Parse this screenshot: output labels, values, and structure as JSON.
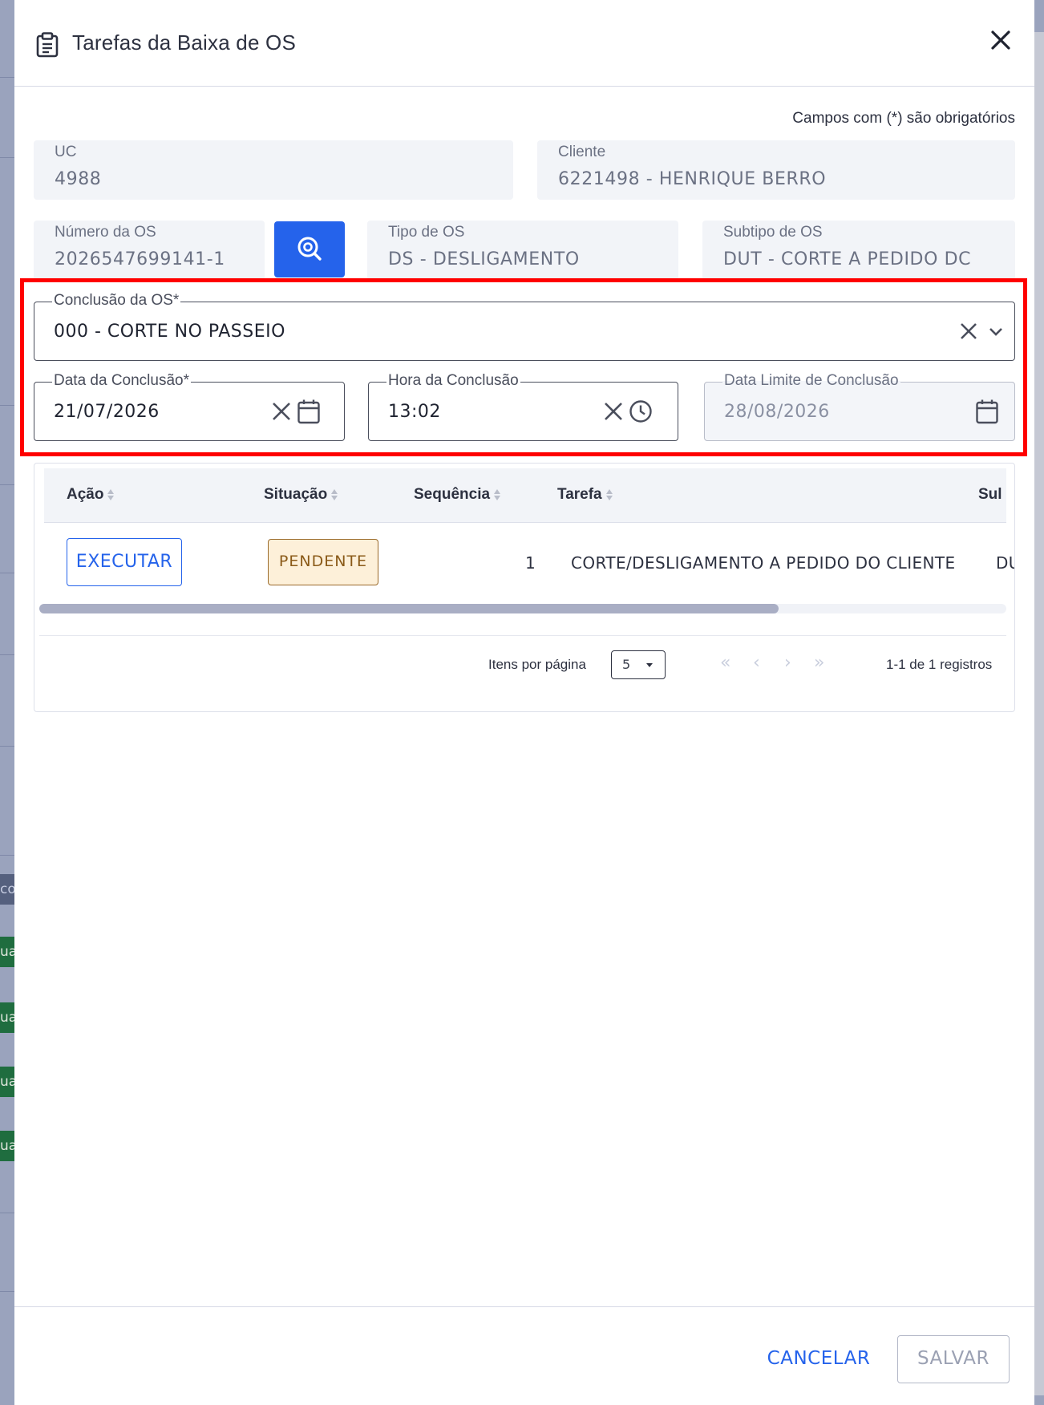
{
  "modal": {
    "title": "Tarefas da Baixa de OS",
    "required_note": "Campos com (*) são obrigatórios"
  },
  "fields": {
    "uc": {
      "label": "UC",
      "value": "4988"
    },
    "cliente": {
      "label": "Cliente",
      "value": "6221498 - HENRIQUE BERRO"
    },
    "numero_os": {
      "label": "Número da OS",
      "value": "2026547699141-1"
    },
    "tipo_os": {
      "label": "Tipo de OS",
      "value": "DS - DESLIGAMENTO"
    },
    "subtipo_os": {
      "label": "Subtipo de OS",
      "value": "DUT - CORTE A PEDIDO DC"
    },
    "conclusao_os": {
      "label": "Conclusão da OS*",
      "value": "000 - CORTE NO PASSEIO"
    },
    "data_conclusao": {
      "label": "Data da Conclusão*",
      "value": "21/07/2026"
    },
    "hora_conclusao": {
      "label": "Hora da Conclusão",
      "value": "13:02"
    },
    "data_limite": {
      "label": "Data Limite de Conclusão",
      "value": "28/08/2026"
    }
  },
  "table": {
    "columns": [
      "Ação",
      "Situação",
      "Sequência",
      "Tarefa",
      "Sul"
    ],
    "rows": [
      {
        "acao": "EXECUTAR",
        "situacao": "PENDENTE",
        "sequencia": "1",
        "tarefa": "CORTE/DESLIGAMENTO A PEDIDO DO CLIENTE",
        "subtipo": "DUT"
      }
    ]
  },
  "pagination": {
    "items_label": "Itens por página",
    "page_size": "5",
    "first": "«",
    "prev": "‹",
    "next": "›",
    "last": "»",
    "info": "1-1 de 1 registros"
  },
  "footer": {
    "cancel_label": "CANCELAR",
    "save_label": "SALVAR"
  },
  "background": {
    "chips": [
      "co",
      "ua",
      "ua",
      "ua",
      "ua"
    ]
  },
  "colors": {
    "primary": "#2563eb",
    "highlight": "#ff0000",
    "pending_bg": "#fdf0d9",
    "pending_border": "#9a6a2a"
  },
  "icons": {
    "header": "clipboard-icon",
    "close": "close-icon",
    "search": "search-icon",
    "clear": "clear-icon",
    "dropdown": "chevron-down-icon",
    "calendar": "calendar-icon",
    "clock": "clock-icon"
  }
}
